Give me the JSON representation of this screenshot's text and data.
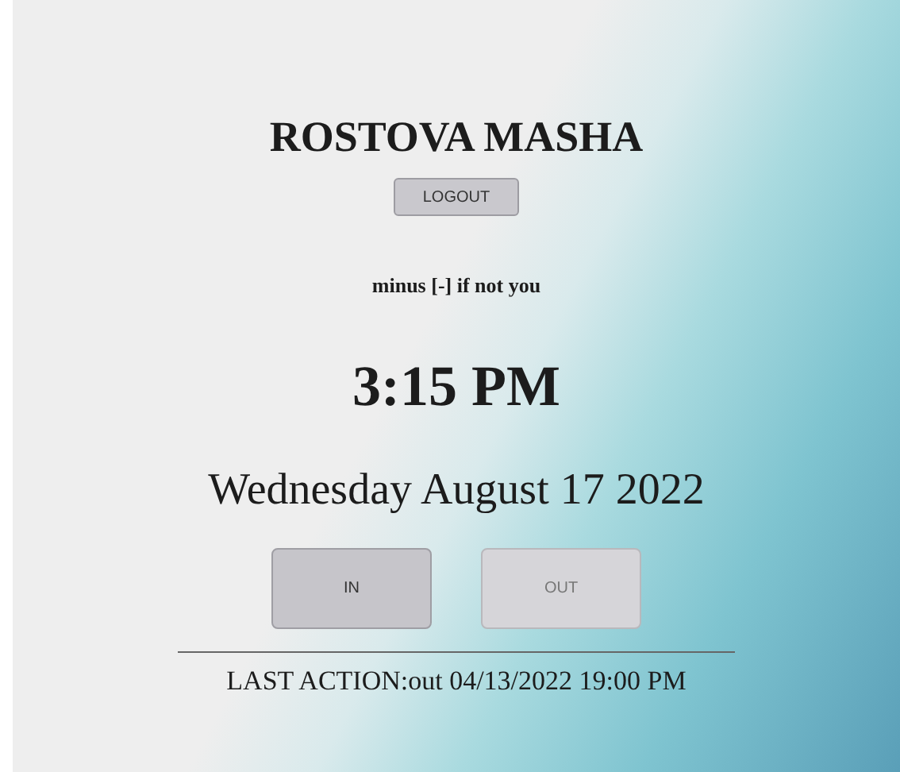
{
  "user": {
    "name": "ROSTOVA MASHA"
  },
  "logout_button": "LOGOUT",
  "hint": "minus [-] if not you",
  "time": "3:15 PM",
  "date": "Wednesday August 17 2022",
  "actions": [
    {
      "label": "IN",
      "disabled": false
    },
    {
      "label": "OUT",
      "disabled": true
    }
  ],
  "last_action": "LAST ACTION:out 04/13/2022 19:00 PM"
}
